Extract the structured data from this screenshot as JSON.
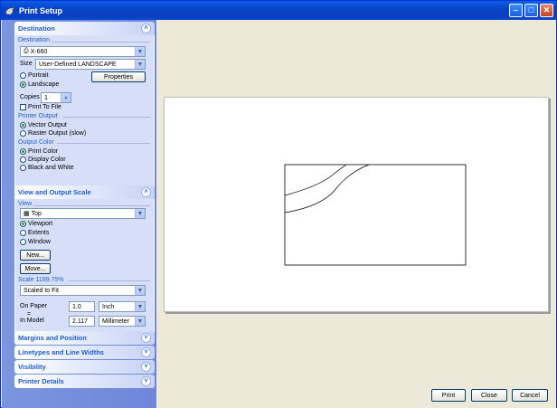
{
  "window": {
    "title": "Print Setup"
  },
  "destination": {
    "header": "Destination",
    "group_label": "Destination",
    "printer": "X-660",
    "size_label": "Size",
    "size_value": "User-Defined LANDSCAPE",
    "portrait_label": "Portrait",
    "landscape_label": "Landscape",
    "properties_label": "Properties",
    "copies_label": "Copies",
    "copies_value": "1",
    "print_to_file_label": "Print To File",
    "printer_output_label": "Printer Output",
    "vector_output_label": "Vector Output",
    "raster_output_label": "Raster Output (slow)",
    "output_color_label": "Output Color",
    "print_color_label": "Print Color",
    "display_color_label": "Display Color",
    "black_white_label": "Black and White"
  },
  "view_scale": {
    "header": "View and Output Scale",
    "view_label": "View",
    "view_value": "Top",
    "viewport_label": "Viewport",
    "extents_label": "Extents",
    "window_label": "Window",
    "new_label": "New...",
    "move_label": "Move...",
    "scale_label": "Scale 1199.75%",
    "scale_value": "Scaled to Fit",
    "on_paper_label": "On Paper",
    "on_paper_value": "1.0",
    "on_paper_unit": "Inch",
    "equals": "=",
    "in_model_label": "In Model",
    "in_model_value": "2.117",
    "in_model_unit": "Millimeter"
  },
  "collapsed_panels": {
    "margins": "Margins and Position",
    "linetypes": "Linetypes and Line Widths",
    "visibility": "Visibility",
    "printer_details": "Printer Details"
  },
  "buttons": {
    "print": "Print",
    "close": "Close",
    "cancel": "Cancel"
  },
  "colors": {
    "accent": "#215dc6",
    "titlebar": "#0a49d0",
    "sidebar": "#7a96df"
  }
}
